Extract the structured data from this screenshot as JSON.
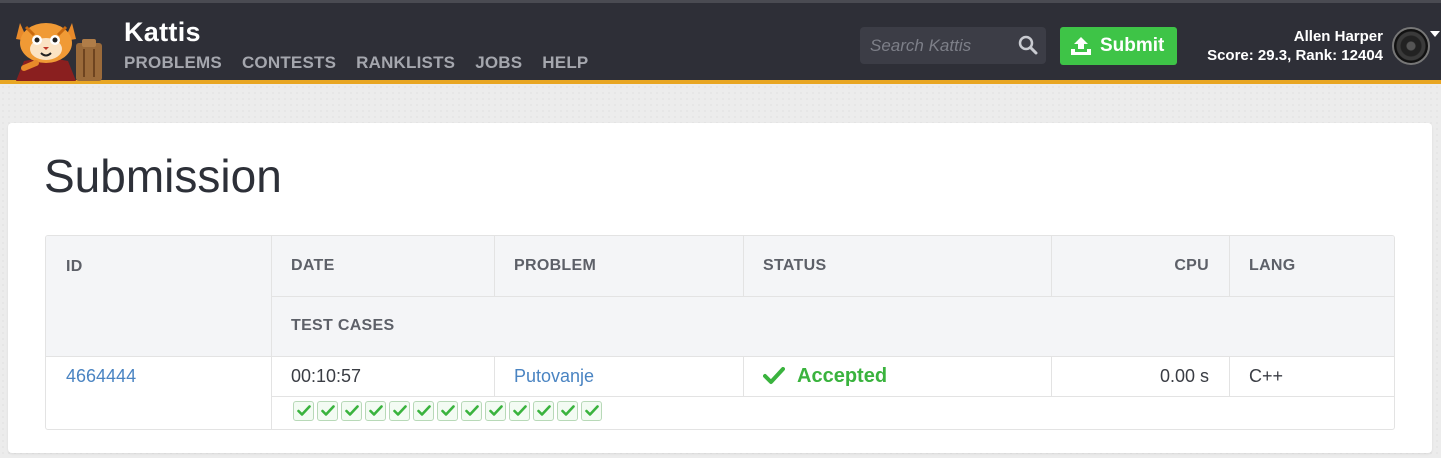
{
  "header": {
    "brand": "Kattis",
    "nav": [
      "PROBLEMS",
      "CONTESTS",
      "RANKLISTS",
      "JOBS",
      "HELP"
    ],
    "search_placeholder": "Search Kattis",
    "submit_label": "Submit",
    "user_name": "Allen Harper",
    "user_stats": "Score: 29.3, Rank: 12404"
  },
  "page": {
    "title": "Submission"
  },
  "table": {
    "headers": {
      "id": "ID",
      "date": "DATE",
      "problem": "PROBLEM",
      "status": "STATUS",
      "cpu": "CPU",
      "lang": "LANG",
      "test_cases": "TEST CASES"
    },
    "row": {
      "id": "4664444",
      "date": "00:10:57",
      "problem": "Putovanje",
      "status": "Accepted",
      "cpu": "0.00 s",
      "lang": "C++",
      "test_cases_passed": 13
    }
  },
  "colors": {
    "accent": "#e8a623",
    "success": "#3ec447",
    "link": "#4a84c2",
    "topbar": "#2e2f37"
  },
  "icons": [
    "kattis-logo",
    "search-icon",
    "upload-icon",
    "check-icon",
    "avatar",
    "caret-down-icon"
  ]
}
